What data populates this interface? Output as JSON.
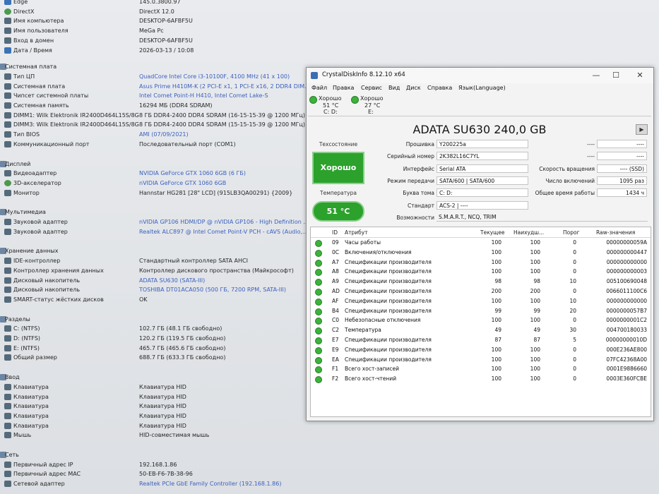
{
  "background": {
    "top_rows": [
      {
        "label": "Edge",
        "value": "145.0.3800.97"
      },
      {
        "label": "DirectX",
        "value": "DirectX 12.0"
      },
      {
        "label": "Имя компьютера",
        "value": "DESKTOP-6AFBF5U"
      },
      {
        "label": "Имя пользователя",
        "value": "MeGa Pc"
      },
      {
        "label": "Вход в домен",
        "value": "DESKTOP-6AFBF5U"
      },
      {
        "label": "Дата / Время",
        "value": "2026-03-13 / 10:08"
      }
    ],
    "sections": [
      {
        "title": "Системная плата",
        "rows": [
          {
            "label": "Тип ЦП",
            "value": "QuadCore Intel Core i3-10100F, 4100 MHz (41 x 100)",
            "link": true
          },
          {
            "label": "Системная плата",
            "value": "Asus Prime H410M-K  (2 PCI-E x1, 1 PCI-E x16, 2 DDR4 DIM...",
            "link": true
          },
          {
            "label": "Чипсет системной платы",
            "value": "Intel Comet Point-H H410, Intel Comet Lake-S",
            "link": true
          },
          {
            "label": "Системная память",
            "value": "16294 МБ  (DDR4 SDRAM)",
            "link": false
          },
          {
            "label": "DIMM1: Wilk Elektronik IR2400D464L15S/8G",
            "value": "8 ГБ DDR4-2400 DDR4 SDRAM  (16-15-15-39 @ 1200 МГц)",
            "link": false
          },
          {
            "label": "DIMM3: Wilk Elektronik IR2400D464L15S/8G",
            "value": "8 ГБ DDR4-2400 DDR4 SDRAM  (15-15-15-39 @ 1200 МГц)",
            "link": false
          },
          {
            "label": "Тип BIOS",
            "value": "AMI (07/09/2021)",
            "link": true
          },
          {
            "label": "Коммуникационный порт",
            "value": "Последовательный порт (COM1)",
            "link": false
          }
        ]
      },
      {
        "title": "Дисплей",
        "rows": [
          {
            "label": "Видеоадаптер",
            "value": "NVIDIA GeForce GTX 1060 6GB  (6 ГБ)",
            "link": true
          },
          {
            "label": "3D-акселератор",
            "value": "nVIDIA GeForce GTX 1060 6GB",
            "link": true
          },
          {
            "label": "Монитор",
            "value": "Hannstar HG281  [28\" LCD]  (915LB3QA00291)  {2009}",
            "link": false
          }
        ]
      },
      {
        "title": "Мультимедиа",
        "rows": [
          {
            "label": "Звуковой адаптер",
            "value": "nVIDIA GP106 HDMI/DP @ nVIDIA GP106 - High Definition ...",
            "link": true
          },
          {
            "label": "Звуковой адаптер",
            "value": "Realtek ALC897 @ Intel Comet Point-V PCH - cAVS (Audio,...",
            "link": true
          }
        ]
      },
      {
        "title": "Хранение данных",
        "rows": [
          {
            "label": "IDE-контроллер",
            "value": "Стандартный контроллер SATA AHCI",
            "link": false
          },
          {
            "label": "Контроллер хранения данных",
            "value": "Контроллер дискового пространства (Майкрософт)",
            "link": false
          },
          {
            "label": "Дисковый накопитель",
            "value": "ADATA SU630  (SATA-III)",
            "link": true
          },
          {
            "label": "Дисковый накопитель",
            "value": "TOSHIBA DT01ACA050  (500 ГБ, 7200 RPM, SATA-III)",
            "link": true
          },
          {
            "label": "SMART-статус жёстких дисков",
            "value": "OK",
            "link": false
          }
        ]
      },
      {
        "title": "Разделы",
        "rows": [
          {
            "label": "C: (NTFS)",
            "value": "102.7 ГБ (48.1 ГБ свободно)",
            "link": false
          },
          {
            "label": "D: (NTFS)",
            "value": "120.2 ГБ (119.5 ГБ свободно)",
            "link": false
          },
          {
            "label": "E: (NTFS)",
            "value": "465.7 ГБ (465.6 ГБ свободно)",
            "link": false
          },
          {
            "label": "Общий размер",
            "value": "688.7 ГБ (633.3 ГБ свободно)",
            "link": false
          }
        ]
      },
      {
        "title": "Ввод",
        "rows": [
          {
            "label": "Клавиатура",
            "value": "Клавиатура HID",
            "link": false
          },
          {
            "label": "Клавиатура",
            "value": "Клавиатура HID",
            "link": false
          },
          {
            "label": "Клавиатура",
            "value": "Клавиатура HID",
            "link": false
          },
          {
            "label": "Клавиатура",
            "value": "Клавиатура HID",
            "link": false
          },
          {
            "label": "Клавиатура",
            "value": "Клавиатура HID",
            "link": false
          },
          {
            "label": "Мышь",
            "value": "HID-совместимая мышь",
            "link": false
          }
        ]
      },
      {
        "title": "Сеть",
        "rows": [
          {
            "label": "Первичный адрес IP",
            "value": "192.168.1.86",
            "link": false
          },
          {
            "label": "Первичный адрес MAC",
            "value": "50-EB-F6-7B-38-96",
            "link": false
          },
          {
            "label": "Сетевой адаптер",
            "value": "Realtek PCIe GbE Family Controller  (192.168.1.86)",
            "link": true
          }
        ]
      }
    ]
  },
  "cdi": {
    "title": "CrystalDiskInfo 8.12.10 x64",
    "window_buttons": {
      "minimize": "—",
      "maximize": "☐",
      "close": "✕"
    },
    "menu": [
      "Файл",
      "Правка",
      "Сервис",
      "Вид",
      "Диск",
      "Справка",
      "Язык(Language)"
    ],
    "drives": [
      {
        "status": "Хорошо",
        "temp": "51 °C",
        "letters": "C: D:"
      },
      {
        "status": "Хорошо",
        "temp": "27 °C",
        "letters": "E:"
      }
    ],
    "model": "ADATA SU630 240,0 GB",
    "health_label": "Техсостояние",
    "health_value": "Хорошо",
    "temp_label": "Температура",
    "temp_value": "51 °C",
    "info": {
      "firmware_label": "Прошивка",
      "firmware": "Y200225a",
      "serial_label": "Серийный номер",
      "serial": "2K382L16C7YL",
      "interface_label": "Интерфейс",
      "interface": "Serial ATA",
      "transfer_label": "Режим передачи",
      "transfer": "SATA/600 | SATA/600",
      "volume_label": "Буква тома",
      "volume": "C: D:",
      "standard_label": "Стандарт",
      "standard": "ACS-2 | ----",
      "features_label": "Возможности",
      "features": "S.M.A.R.T., NCQ, TRIM",
      "right1_label": "----",
      "right1": "----",
      "right2_label": "----",
      "right2": "----",
      "rotation_label": "Скорость вращения",
      "rotation": "---- (SSD)",
      "power_count_label": "Число включений",
      "power_count": "1095 раз",
      "power_hours_label": "Общее время работы",
      "power_hours": "1434 ч"
    },
    "table": {
      "headers": {
        "id": "ID",
        "attr": "Атрибут",
        "current": "Текущее",
        "worst": "Наихудш...",
        "threshold": "Порог",
        "raw": "Raw-значения"
      },
      "rows": [
        {
          "id": "09",
          "name": "Часы работы",
          "current": "100",
          "worst": "100",
          "threshold": "0",
          "raw": "00000000059A"
        },
        {
          "id": "0C",
          "name": "Включения/отключения",
          "current": "100",
          "worst": "100",
          "threshold": "0",
          "raw": "000000000447"
        },
        {
          "id": "A7",
          "name": "Спецификации производителя",
          "current": "100",
          "worst": "100",
          "threshold": "0",
          "raw": "000000000000"
        },
        {
          "id": "A8",
          "name": "Спецификации производителя",
          "current": "100",
          "worst": "100",
          "threshold": "0",
          "raw": "000000000003"
        },
        {
          "id": "A9",
          "name": "Спецификации производителя",
          "current": "98",
          "worst": "98",
          "threshold": "10",
          "raw": "005100690048"
        },
        {
          "id": "AD",
          "name": "Спецификации производителя",
          "current": "200",
          "worst": "200",
          "threshold": "0",
          "raw": "0066011100C6"
        },
        {
          "id": "AF",
          "name": "Спецификации производителя",
          "current": "100",
          "worst": "100",
          "threshold": "10",
          "raw": "000000000000"
        },
        {
          "id": "B4",
          "name": "Спецификации производителя",
          "current": "99",
          "worst": "99",
          "threshold": "20",
          "raw": "0000000057B7"
        },
        {
          "id": "C0",
          "name": "Небезопасные отключения",
          "current": "100",
          "worst": "100",
          "threshold": "0",
          "raw": "0000000001C2"
        },
        {
          "id": "C2",
          "name": "Температура",
          "current": "49",
          "worst": "49",
          "threshold": "30",
          "raw": "004700180033"
        },
        {
          "id": "E7",
          "name": "Спецификации производителя",
          "current": "87",
          "worst": "87",
          "threshold": "5",
          "raw": "00000000010D"
        },
        {
          "id": "E9",
          "name": "Спецификации производителя",
          "current": "100",
          "worst": "100",
          "threshold": "0",
          "raw": "000E236AE800"
        },
        {
          "id": "EA",
          "name": "Спецификации производителя",
          "current": "100",
          "worst": "100",
          "threshold": "0",
          "raw": "07FC42368A00"
        },
        {
          "id": "F1",
          "name": "Всего хост-записей",
          "current": "100",
          "worst": "100",
          "threshold": "0",
          "raw": "0001E9886660"
        },
        {
          "id": "F2",
          "name": "Всего хост-чтений",
          "current": "100",
          "worst": "100",
          "threshold": "0",
          "raw": "0003E360FCBE"
        }
      ]
    },
    "colors": {
      "good": "#2ca12c",
      "link": "#3a5fbe"
    }
  }
}
